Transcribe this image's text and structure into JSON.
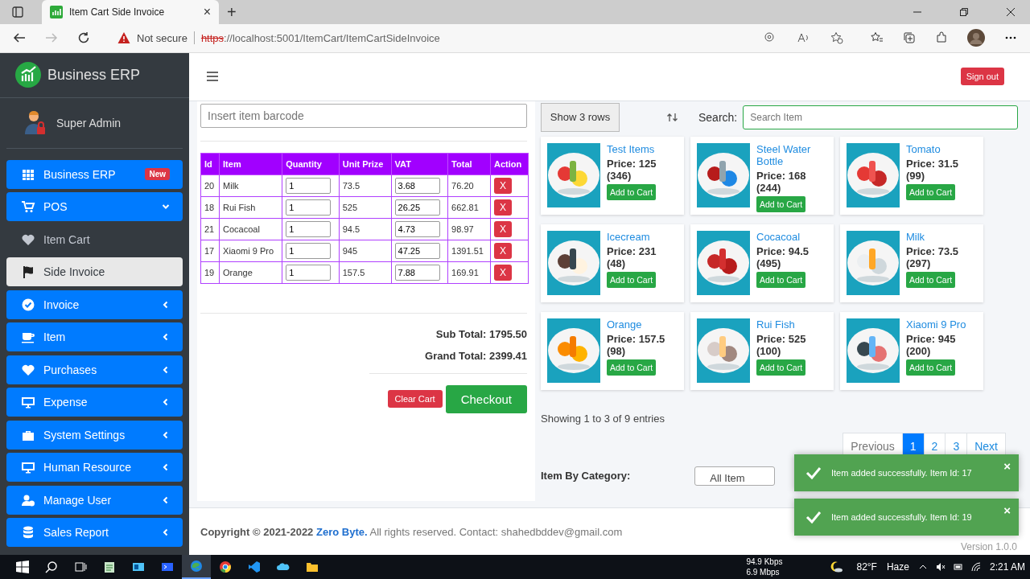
{
  "browser": {
    "tab_title": "Item Cart Side Invoice",
    "tab_close": "×",
    "new_tab": "+",
    "security": "Not secure",
    "url_scheme": "https",
    "url_rest": "://localhost:5001/ItemCart/ItemCartSideInvoice"
  },
  "sidebar": {
    "brand": "Business ERP",
    "user": "Super Admin",
    "items": [
      {
        "label": "Business ERP",
        "kind": "link",
        "badge": "New"
      },
      {
        "label": "POS",
        "kind": "group",
        "expanded": true
      },
      {
        "label": "Item Cart",
        "kind": "sub",
        "selected": false
      },
      {
        "label": "Side Invoice",
        "kind": "sub",
        "selected": true
      },
      {
        "label": "Invoice",
        "kind": "group",
        "expanded": false
      },
      {
        "label": "Item",
        "kind": "group",
        "expanded": false
      },
      {
        "label": "Purchases",
        "kind": "group",
        "expanded": false
      },
      {
        "label": "Expense",
        "kind": "group",
        "expanded": false
      },
      {
        "label": "System Settings",
        "kind": "group",
        "expanded": false
      },
      {
        "label": "Human Resource",
        "kind": "group",
        "expanded": false
      },
      {
        "label": "Manage User",
        "kind": "group",
        "expanded": false
      },
      {
        "label": "Sales Report",
        "kind": "group",
        "expanded": false
      }
    ]
  },
  "navbar": {
    "sign_out": "Sign out"
  },
  "cart": {
    "barcode_placeholder": "Insert item barcode",
    "columns": [
      "Id",
      "Item",
      "Quantity",
      "Unit Prize",
      "VAT",
      "Total",
      "Action"
    ],
    "rows": [
      {
        "id": "20",
        "item": "Milk",
        "quantity": "1",
        "unit_prize": "73.5",
        "vat": "3.68",
        "total": "76.20",
        "action": "X"
      },
      {
        "id": "18",
        "item": "Rui Fish",
        "quantity": "1",
        "unit_prize": "525",
        "vat": "26.25",
        "total": "662.81",
        "action": "X"
      },
      {
        "id": "21",
        "item": "Cocacoal",
        "quantity": "1",
        "unit_prize": "94.5",
        "vat": "4.73",
        "total": "98.97",
        "action": "X"
      },
      {
        "id": "17",
        "item": "Xiaomi 9 Pro",
        "quantity": "1",
        "unit_prize": "945",
        "vat": "47.25",
        "total": "1391.51",
        "action": "X"
      },
      {
        "id": "19",
        "item": "Orange",
        "quantity": "1",
        "unit_prize": "157.5",
        "vat": "7.88",
        "total": "169.91",
        "action": "X"
      }
    ],
    "sub_total": "Sub Total: 1795.50",
    "grand_total": "Grand Total: 2399.41",
    "clear": "Clear Cart",
    "checkout": "Checkout"
  },
  "products": {
    "show_rows": "Show 3 rows",
    "search_label": "Search:",
    "search_placeholder": "Search Item",
    "items": [
      {
        "name": "Test Items",
        "price": "Price: 125",
        "stock": "(346)",
        "button": "Add to Cart"
      },
      {
        "name": "Steel Water Bottle",
        "price": "Price: 168",
        "stock": "(244)",
        "button": "Add to Cart"
      },
      {
        "name": "Tomato",
        "price": "Price: 31.5",
        "stock": "(99)",
        "button": "Add to Cart"
      },
      {
        "name": "Icecream",
        "price": "Price: 231",
        "stock": "(48)",
        "button": "Add to Cart"
      },
      {
        "name": "Cocacoal",
        "price": "Price: 94.5",
        "stock": "(495)",
        "button": "Add to Cart"
      },
      {
        "name": "Milk",
        "price": "Price: 73.5",
        "stock": "(297)",
        "button": "Add to Cart"
      },
      {
        "name": "Orange",
        "price": "Price: 157.5",
        "stock": "(98)",
        "button": "Add to Cart"
      },
      {
        "name": "Rui Fish",
        "price": "Price: 525",
        "stock": "(100)",
        "button": "Add to Cart"
      },
      {
        "name": "Xiaomi 9 Pro",
        "price": "Price: 945",
        "stock": "(200)",
        "button": "Add to Cart"
      }
    ],
    "showing": "Showing 1 to 3 of 9 entries",
    "pages": [
      {
        "label": "Previous",
        "selected": false
      },
      {
        "label": "1",
        "selected": true
      },
      {
        "label": "2",
        "selected": false
      },
      {
        "label": "3",
        "selected": false
      },
      {
        "label": "Next",
        "selected": false
      }
    ],
    "category_label": "Item By Category:",
    "category_value": "All Item"
  },
  "footer": {
    "copyright": "Copyright © 2021-2022",
    "company": "Zero Byte.",
    "rest": "All rights reserved. Contact: shahedbddev@gmail.com",
    "version": "Version 1.0.0"
  },
  "toasts": [
    {
      "message": "Item added successfully. Item Id: 17",
      "close": "×"
    },
    {
      "message": "Item added successfully. Item Id: 19",
      "close": "×"
    }
  ],
  "taskbar": {
    "upload": "94.9 Kbps",
    "download": "6.9 Mbps",
    "temperature": "82°F",
    "weather": "Haze",
    "time": "2:21 AM"
  }
}
